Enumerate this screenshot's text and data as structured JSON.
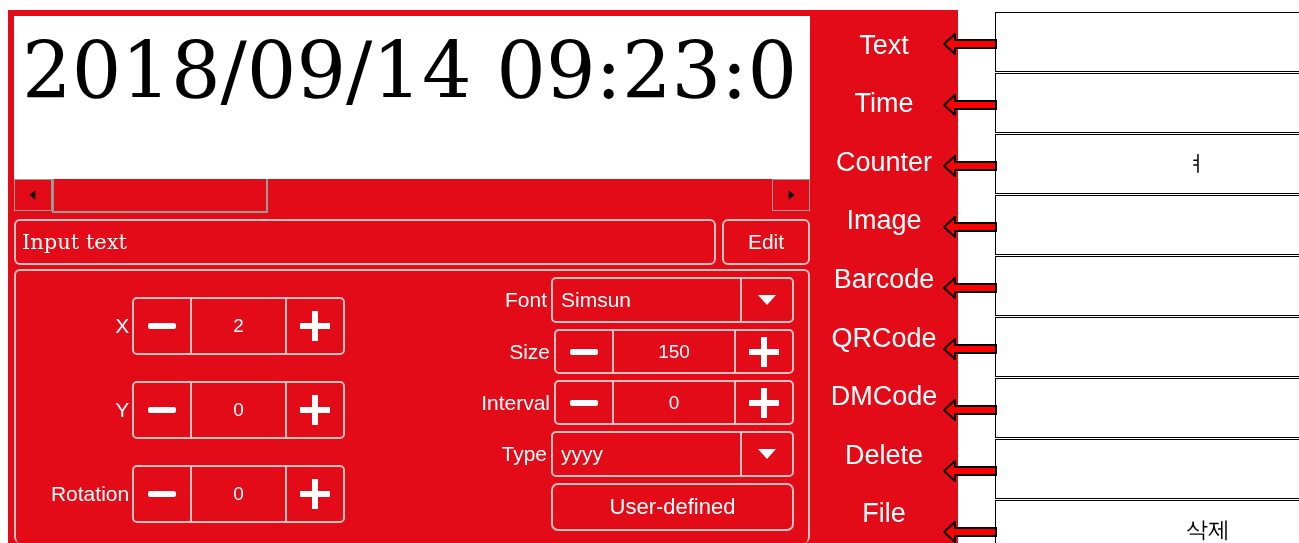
{
  "preview": {
    "text": "2018/09/14 09:23:0"
  },
  "input": {
    "placeholder": "Input text"
  },
  "edit_button": "Edit",
  "left_fields": [
    {
      "kind": "stepper",
      "label": "X",
      "value": "2"
    },
    {
      "kind": "stepper",
      "label": "Y",
      "value": "0"
    },
    {
      "kind": "stepper",
      "label": "Rotation",
      "value": "0"
    }
  ],
  "right_fields": [
    {
      "kind": "dropdown",
      "label": "Font",
      "value": "Simsun"
    },
    {
      "kind": "stepper",
      "label": "Size",
      "value": "150"
    },
    {
      "kind": "stepper",
      "label": "Interval",
      "value": "0"
    },
    {
      "kind": "dropdown",
      "label": "Type",
      "value": "yyyy"
    },
    {
      "kind": "button",
      "label": "User-defined"
    }
  ],
  "menu": [
    {
      "label": "Text"
    },
    {
      "label": "Time"
    },
    {
      "label": "Counter",
      "note": "ㅕ"
    },
    {
      "label": "Image"
    },
    {
      "label": "Barcode"
    },
    {
      "label": "QRCode"
    },
    {
      "label": "DMCode"
    },
    {
      "label": "Delete"
    },
    {
      "label": "File",
      "note": "삭제"
    }
  ]
}
